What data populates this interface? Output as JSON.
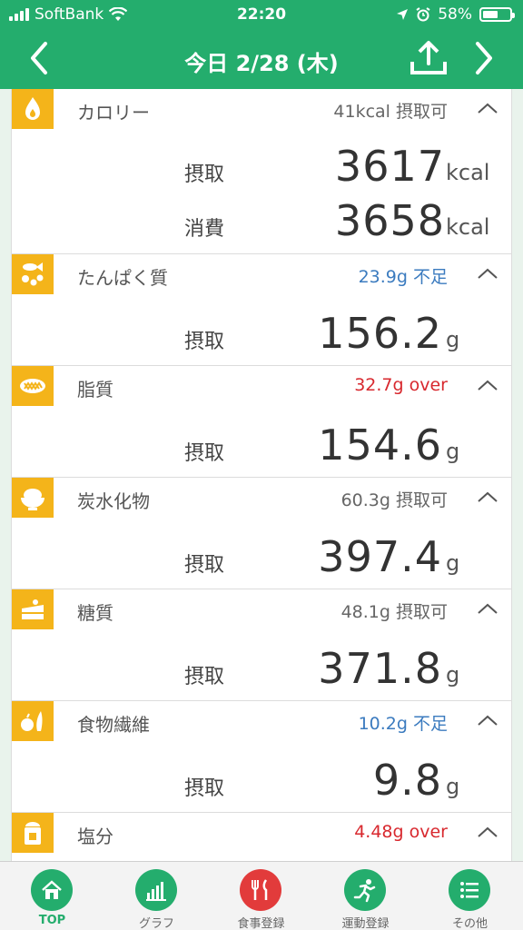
{
  "status_bar": {
    "carrier": "SoftBank",
    "time": "22:20",
    "battery": "58%",
    "battery_level": 0.58
  },
  "header": {
    "title": "今日 2/28 (木)",
    "prev_icon": "chevron-left-icon",
    "next_icon": "chevron-right-icon",
    "upload_icon": "upload-icon"
  },
  "sections": [
    {
      "id": "calorie",
      "icon": "flame-icon",
      "name": "カロリー",
      "status": "41kcal 摂取可",
      "status_type": "ok",
      "rows": [
        {
          "label": "摂取",
          "value": "3617",
          "unit": "kcal"
        },
        {
          "label": "消費",
          "value": "3658",
          "unit": "kcal"
        }
      ]
    },
    {
      "id": "protein",
      "icon": "fish-beans-icon",
      "name": "たんぱく質",
      "status": "23.9g 不足",
      "status_type": "under",
      "rows": [
        {
          "label": "摂取",
          "value": "156.2",
          "unit": "g"
        }
      ]
    },
    {
      "id": "fat",
      "icon": "fat-icon",
      "name": "脂質",
      "status": "32.7g over",
      "status_type": "over",
      "rows": [
        {
          "label": "摂取",
          "value": "154.6",
          "unit": "g"
        }
      ]
    },
    {
      "id": "carb",
      "icon": "rice-bowl-icon",
      "name": "炭水化物",
      "status": "60.3g 摂取可",
      "status_type": "ok",
      "rows": [
        {
          "label": "摂取",
          "value": "397.4",
          "unit": "g"
        }
      ]
    },
    {
      "id": "sugar",
      "icon": "cake-icon",
      "name": "糖質",
      "status": "48.1g 摂取可",
      "status_type": "ok",
      "rows": [
        {
          "label": "摂取",
          "value": "371.8",
          "unit": "g"
        }
      ]
    },
    {
      "id": "fiber",
      "icon": "vegetable-icon",
      "name": "食物繊維",
      "status": "10.2g 不足",
      "status_type": "under",
      "rows": [
        {
          "label": "摂取",
          "value": "9.8",
          "unit": "g"
        }
      ]
    },
    {
      "id": "salt",
      "icon": "salt-shaker-icon",
      "name": "塩分",
      "status": "4.48g over",
      "status_type": "over",
      "rows": []
    }
  ],
  "tabbar": [
    {
      "label": "TOP",
      "icon": "home-icon",
      "active": true
    },
    {
      "label": "グラフ",
      "icon": "bar-chart-icon",
      "active": false
    },
    {
      "label": "食事登録",
      "icon": "fork-knife-icon",
      "active": false
    },
    {
      "label": "運動登録",
      "icon": "running-icon",
      "active": false
    },
    {
      "label": "その他",
      "icon": "list-icon",
      "active": false
    }
  ],
  "colors": {
    "brand": "#24ad6d",
    "icon_bg": "#f4b41a",
    "under": "#3b7bbf",
    "over": "#d8282e"
  }
}
